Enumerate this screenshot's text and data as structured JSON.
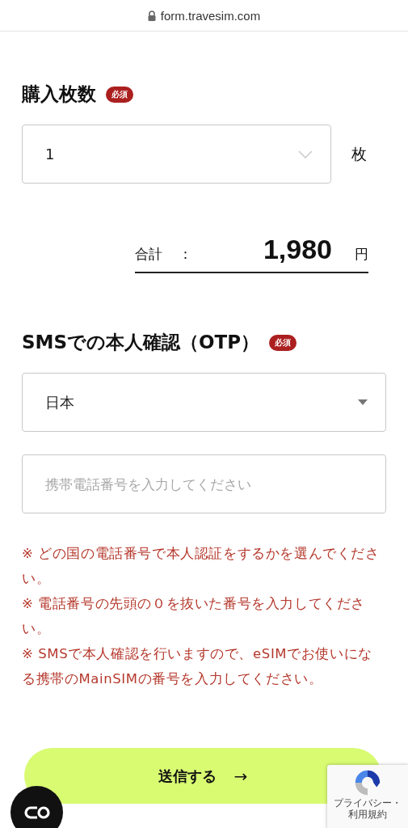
{
  "browser": {
    "url": "form.travesim.com"
  },
  "quantity": {
    "title": "購入枚数",
    "badge": "必須",
    "value": "1",
    "unit": "枚"
  },
  "total": {
    "label": "合計",
    "separator": "：",
    "amount": "1,980",
    "currency": "円"
  },
  "otp": {
    "title": "SMSでの本人確認（OTP）",
    "badge": "必須",
    "country": "日本",
    "phone": {
      "placeholder": "携帯電話番号を入力してください"
    },
    "notes": [
      "※ どの国の電話番号で本人認証をするかを選んでください。",
      "※ 電話番号の先頭の０を抜いた番号を入力してください。",
      "※ SMSで本人確認を行いますので、eSIMでお使いになる携帯のMainSIMの番号を入力してください。"
    ]
  },
  "submit": {
    "label": "送信する",
    "arrow": "→"
  },
  "recaptcha": {
    "links": [
      "プライバシー",
      "利用規約"
    ],
    "separator": "・"
  }
}
